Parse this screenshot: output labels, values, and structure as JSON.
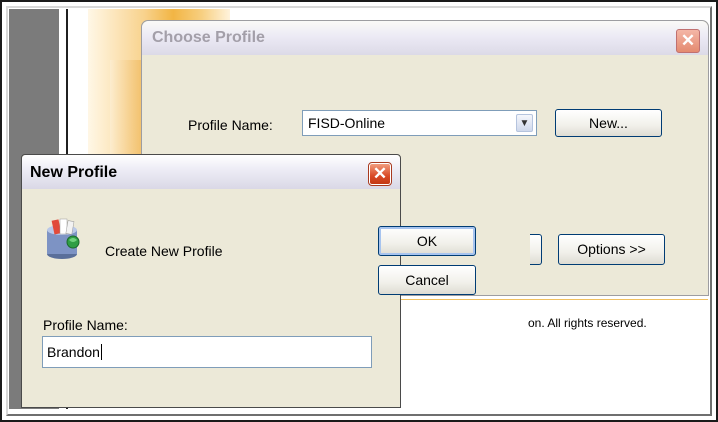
{
  "choose_dialog": {
    "title": "Choose Profile",
    "close_glyph": "✕",
    "profile_label": "Profile Name:",
    "profile_value": "FISD-Online",
    "new_button": "New...",
    "options_button": "Options >>",
    "copyright_fragment": "on.  All rights reserved."
  },
  "new_dialog": {
    "title": "New Profile",
    "close_glyph": "✕",
    "heading": "Create New Profile",
    "ok_button": "OK",
    "cancel_button": "Cancel",
    "name_label": "Profile Name:",
    "name_value": "Brandon",
    "icon": "profile-server-icon"
  }
}
